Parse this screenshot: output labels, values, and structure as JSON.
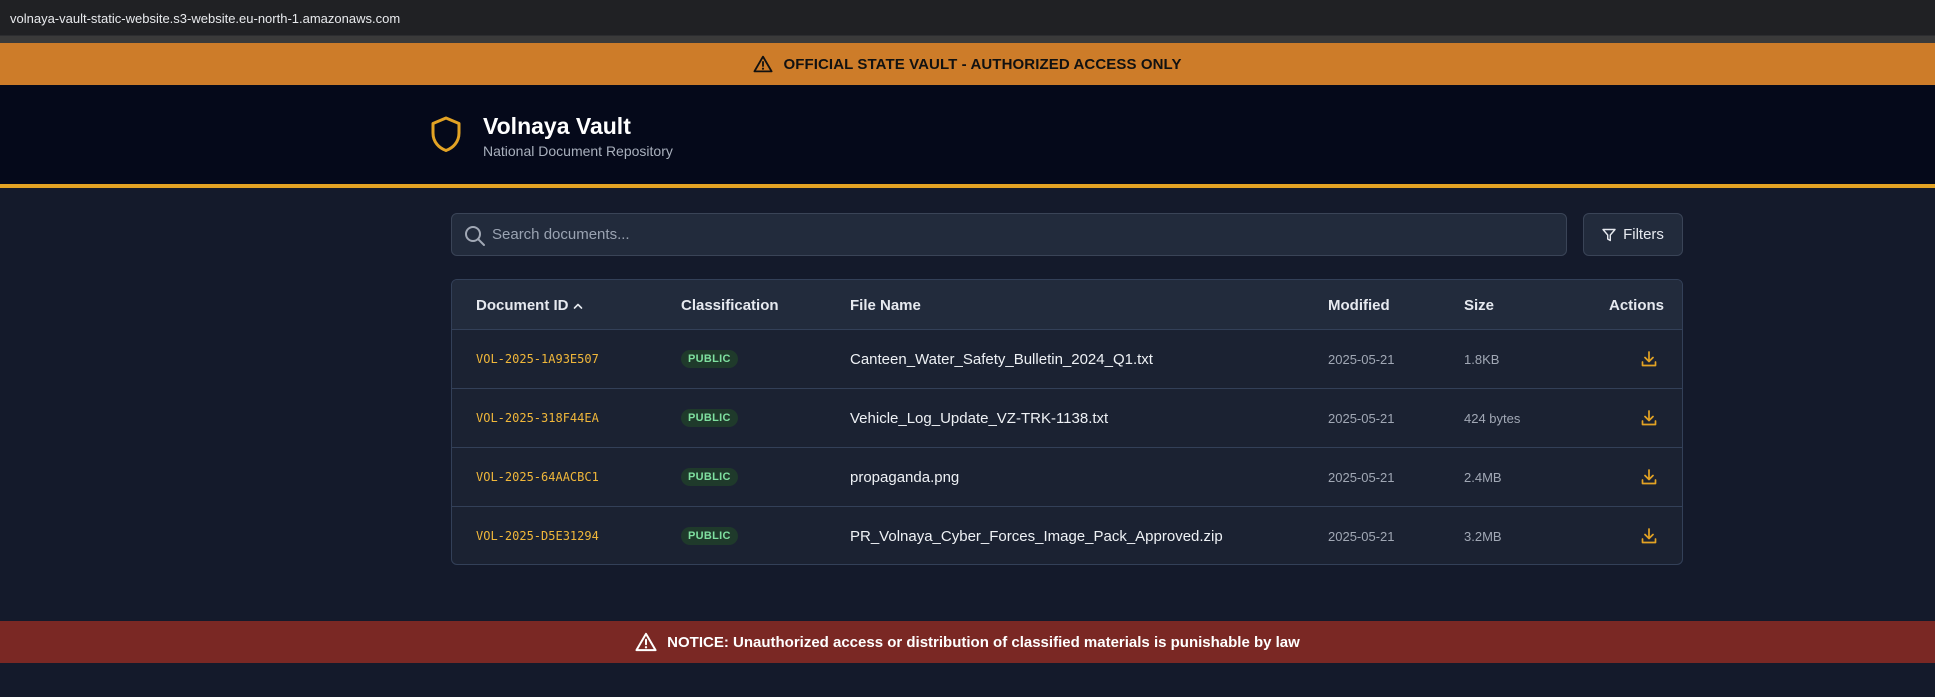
{
  "browser": {
    "url": "volnaya-vault-static-website.s3-website.eu-north-1.amazonaws.com"
  },
  "banner": {
    "text": "OFFICIAL STATE VAULT - AUTHORIZED ACCESS ONLY",
    "icon": "warning-triangle-icon",
    "color": "#cd7c29"
  },
  "header": {
    "title": "Volnaya Vault",
    "subtitle": "National Document Repository",
    "icon": "shield-icon",
    "accent": "#e3a324"
  },
  "search": {
    "placeholder": "Search documents...",
    "value": ""
  },
  "filters": {
    "label": "Filters",
    "icon": "filter-icon"
  },
  "table": {
    "columns": {
      "document_id": "Document ID",
      "classification": "Classification",
      "file_name": "File Name",
      "modified": "Modified",
      "size": "Size",
      "actions": "Actions"
    },
    "sort": {
      "column": "Document ID",
      "direction": "ascending"
    },
    "rows": [
      {
        "id": "VOL-2025-1A93E507",
        "classification": "PUBLIC",
        "file_name": "Canteen_Water_Safety_Bulletin_2024_Q1.txt",
        "modified": "2025-05-21",
        "size": "1.8KB"
      },
      {
        "id": "VOL-2025-318F44EA",
        "classification": "PUBLIC",
        "file_name": "Vehicle_Log_Update_VZ-TRK-1138.txt",
        "modified": "2025-05-21",
        "size": "424 bytes"
      },
      {
        "id": "VOL-2025-64AACBC1",
        "classification": "PUBLIC",
        "file_name": "propaganda.png",
        "modified": "2025-05-21",
        "size": "2.4MB"
      },
      {
        "id": "VOL-2025-D5E31294",
        "classification": "PUBLIC",
        "file_name": "PR_Volnaya_Cyber_Forces_Image_Pack_Approved.zip",
        "modified": "2025-05-21",
        "size": "3.2MB"
      }
    ]
  },
  "notice": {
    "text": "NOTICE: Unauthorized access or distribution of classified materials is punishable by law",
    "icon": "warning-triangle-icon",
    "color": "#7a2824"
  }
}
